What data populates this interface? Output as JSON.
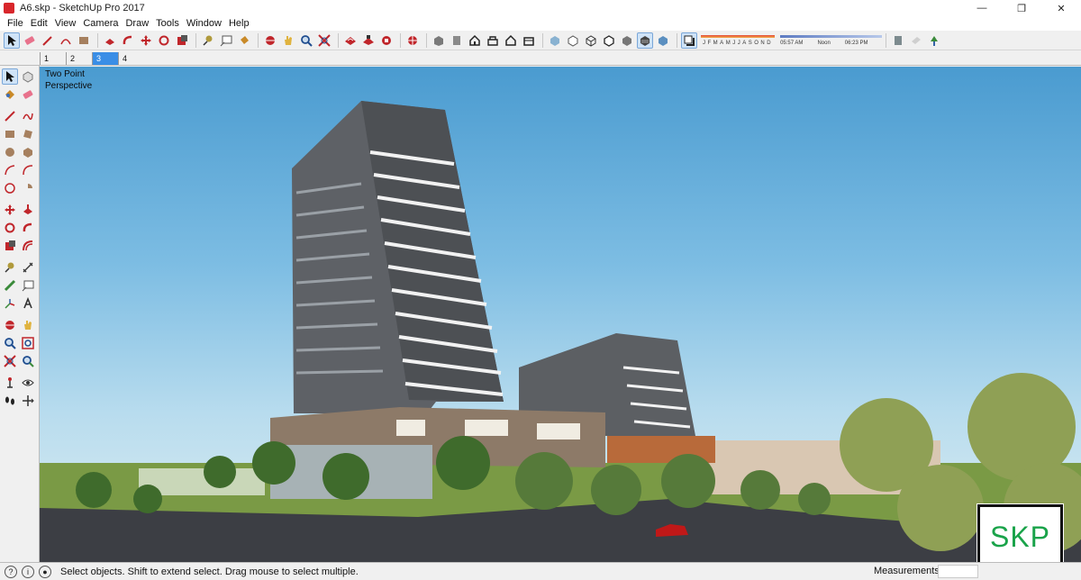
{
  "window": {
    "title": "A6.skp - SketchUp Pro 2017"
  },
  "menu": [
    "File",
    "Edit",
    "View",
    "Camera",
    "Draw",
    "Tools",
    "Window",
    "Help"
  ],
  "scene_tabs": [
    {
      "label": "1",
      "active": false
    },
    {
      "label": "2",
      "active": false
    },
    {
      "label": "3",
      "active": true
    },
    {
      "label": "4",
      "active": false
    }
  ],
  "shadow": {
    "months": [
      "J",
      "F",
      "M",
      "A",
      "M",
      "J",
      "J",
      "A",
      "S",
      "O",
      "N",
      "D"
    ],
    "times": [
      "05:57 AM",
      "Noon",
      "06:23 PM"
    ]
  },
  "viewport": {
    "camera_label_line1": "Two Point",
    "camera_label_line2": "Perspective"
  },
  "watermark": {
    "text": "SKP"
  },
  "status": {
    "hint": "Select objects. Shift to extend select. Drag mouse to select multiple.",
    "measurements_label": "Measurements",
    "measurements_value": ""
  },
  "colors": {
    "sky_top": "#4a9bd0",
    "active_tab": "#3a8ee6",
    "watermark_text": "#1aa34a",
    "icon_red": "#c0262b"
  }
}
